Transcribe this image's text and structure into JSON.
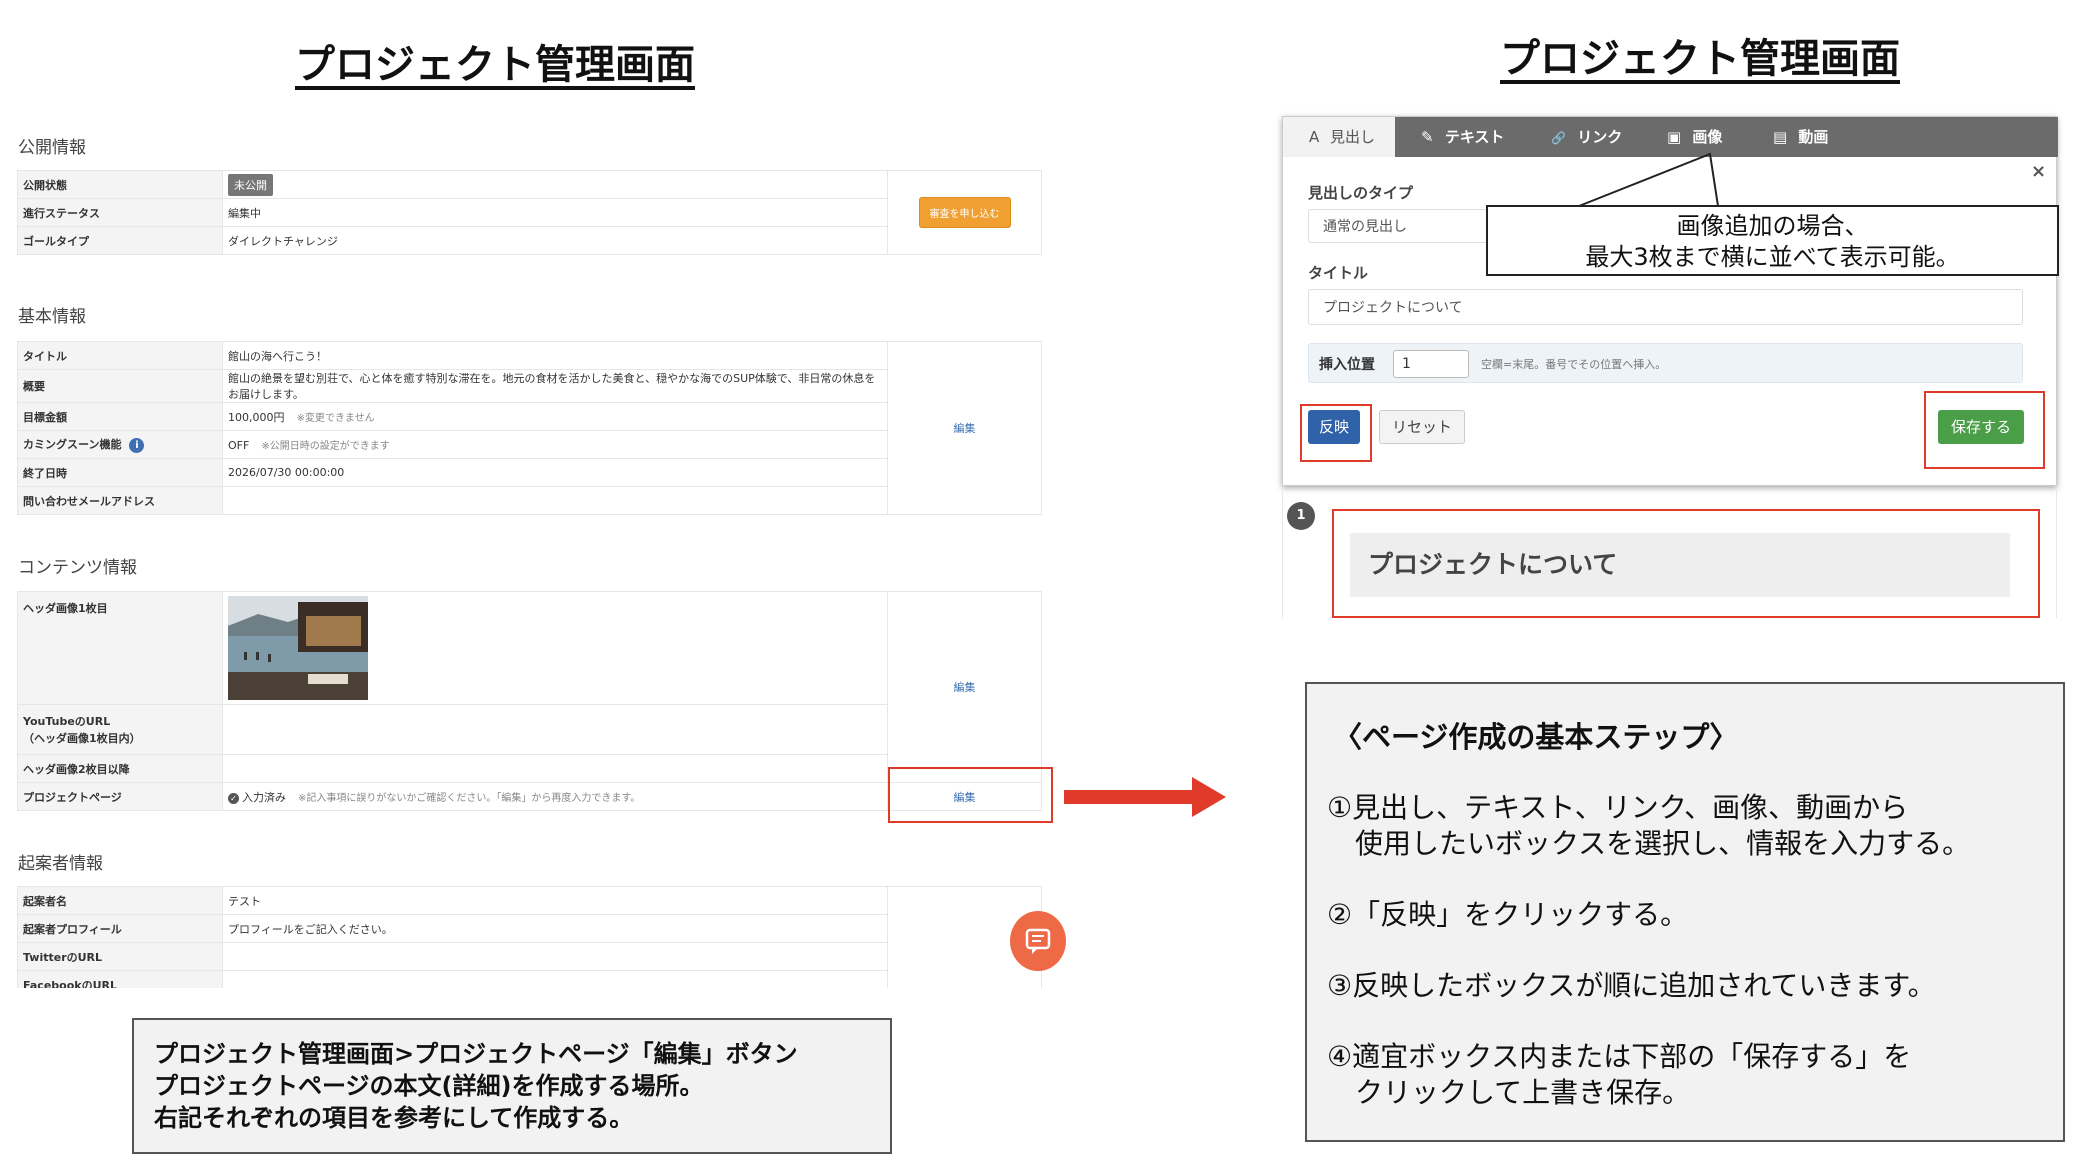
{
  "left": {
    "title": "プロジェクト管理画面",
    "sections": {
      "public": {
        "title": "公開情報",
        "rows": [
          {
            "label": "公開状態",
            "value": "未公開"
          },
          {
            "label": "進行ステータス",
            "value": "編集中"
          },
          {
            "label": "ゴールタイプ",
            "value": "ダイレクトチャレンジ"
          }
        ],
        "action": "審査を申し込む"
      },
      "basic": {
        "title": "基本情報",
        "rows": [
          {
            "label": "タイトル",
            "value": "館山の海へ行こう！",
            "note": ""
          },
          {
            "label": "概要",
            "value": "館山の絶景を望む別荘で、心と体を癒す特別な滞在を。地元の食材を活かした美食と、穏やかな海でのSUP体験で、非日常の休息をお届けします。",
            "note": ""
          },
          {
            "label": "目標金額",
            "value": "100,000円",
            "note": "※変更できません"
          },
          {
            "label": "カミングスーン機能",
            "value": "OFF",
            "note": "※公開日時の設定ができます"
          },
          {
            "label": "終了日時",
            "value": "2026/07/30 00:00:00",
            "note": ""
          },
          {
            "label": "問い合わせメールアドレス",
            "value": "",
            "note": ""
          }
        ],
        "action": "編集"
      },
      "content": {
        "title": "コンテンツ情報",
        "header_image_label": "ヘッダ画像1枚目",
        "youtube_label": "YouTubeのURL\n（ヘッダ画像1枚目内）",
        "header_image2_label": "ヘッダ画像2枚目以降",
        "project_page_label": "プロジェクトページ",
        "project_page_status": "入力済み",
        "project_page_note": "※記入事項に誤りがないかご確認ください。「編集」から再度入力できます。",
        "action": "編集",
        "project_page_action": "編集"
      },
      "proposer": {
        "title": "起案者情報",
        "rows": [
          {
            "label": "起案者名",
            "value": "テスト"
          },
          {
            "label": "起案者プロフィール",
            "value": "プロフィールをご記入ください。"
          },
          {
            "label": "TwitterのURL",
            "value": ""
          },
          {
            "label": "FacebookのURL",
            "value": ""
          }
        ]
      }
    },
    "caption": {
      "line1": "プロジェクト管理画面>プロジェクトページ「編集」ボタン",
      "line2": "プロジェクトページの本文(詳細)を作成する場所。",
      "line3": "右記それぞれの項目を参考にして作成する。"
    }
  },
  "right": {
    "title": "プロジェクト管理画面",
    "tabs": [
      {
        "icon": "A",
        "label": "見出し"
      },
      {
        "icon": "✎",
        "label": "テキスト"
      },
      {
        "icon": "🔗",
        "label": "リンク"
      },
      {
        "icon": "▣",
        "label": "画像"
      },
      {
        "icon": "▤",
        "label": "動画"
      }
    ],
    "form": {
      "heading_type_label": "見出しのタイプ",
      "heading_type_value": "通常の見出し",
      "title_label": "タイトル",
      "title_value": "プロジェクトについて",
      "insert_label": "挿入位置",
      "insert_value": "1",
      "insert_hint": "空欄=末尾。番号でその位置へ挿入。",
      "apply_button": "反映",
      "reset_button": "リセット",
      "save_button": "保存する",
      "close": "×"
    },
    "callout": {
      "line1": "画像追加の場合、",
      "line2": "最大3枚まで横に並べて表示可能。"
    },
    "preview": {
      "number": "1",
      "heading": "プロジェクトについて"
    },
    "steps": {
      "title": "〈ページ作成の基本ステップ〉",
      "items": [
        "①見出し、テキスト、リンク、画像、動画から\n　使用したいボックスを選択し、情報を入力する。",
        "②「反映」をクリックする。",
        "③反映したボックスが順に追加されていきます。",
        "④適宜ボックス内または下部の「保存する」を\n　クリックして上書き保存。"
      ]
    }
  },
  "colors": {
    "red": "#e03a2a",
    "tabbar": "#6b6b6b",
    "apply_blue": "#2f62a8",
    "save_green": "#4a9e48",
    "orange": "#f0a030"
  }
}
